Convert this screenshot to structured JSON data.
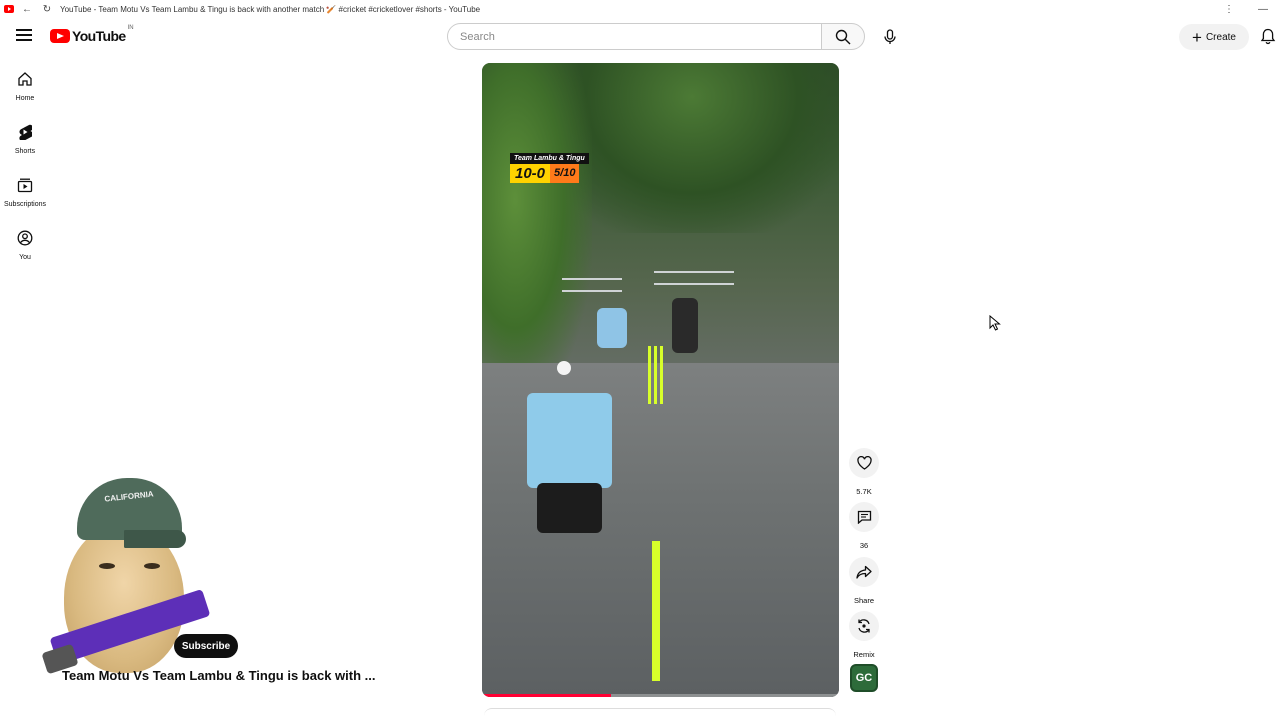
{
  "browser": {
    "tab_title": "YouTube - Team Motu Vs Team Lambu & Tingu is back with another match 🏏 #cricket #cricketlover #shorts - YouTube",
    "back_glyph": "←",
    "reload_glyph": "↻",
    "menu_glyph": "⋮",
    "minimize_glyph": "—"
  },
  "masthead": {
    "logo_text": "YouTube",
    "country_code": "IN",
    "search_placeholder": "Search",
    "create_label": "Create"
  },
  "guide": {
    "items": [
      {
        "label": "Home",
        "icon": "home-icon"
      },
      {
        "label": "Shorts",
        "icon": "shorts-icon"
      },
      {
        "label": "Subscriptions",
        "icon": "subscriptions-icon"
      },
      {
        "label": "You",
        "icon": "you-icon"
      }
    ]
  },
  "video": {
    "scoreboard": {
      "team": "Team Lambu & Tingu",
      "runs": "10-0",
      "overs": "5/10"
    },
    "progress_fraction": 0.36
  },
  "actions": {
    "like_count": "5.7K",
    "comment_count": "36",
    "share_label": "Share",
    "remix_label": "Remix",
    "channel_initials": "GC"
  },
  "overlay": {
    "cap_text": "CALIFORNIA",
    "subscribe_label": "Subscribe",
    "short_title": "Team Motu Vs Team Lambu & Tingu is back with ..."
  }
}
